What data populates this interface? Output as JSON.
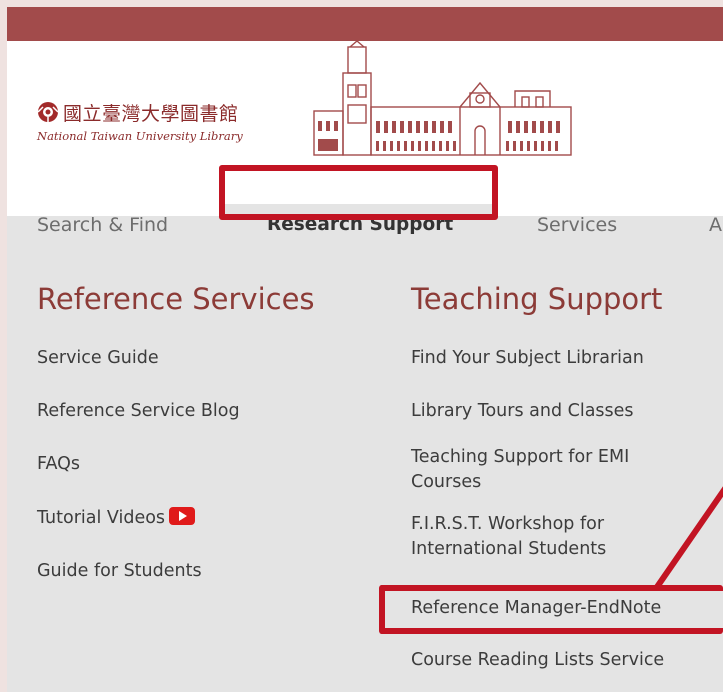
{
  "logo": {
    "name_zh": "國立臺灣大學圖書館",
    "name_en": "National Taiwan University Library"
  },
  "nav": {
    "items": [
      {
        "label": "Search & Find"
      },
      {
        "label": "Research Support"
      },
      {
        "label": "Services"
      },
      {
        "label": "A"
      }
    ]
  },
  "menu": {
    "reference_services": {
      "title": "Reference Services",
      "links": [
        "Service Guide",
        "Reference Service Blog",
        "FAQs",
        "Tutorial Videos",
        "Guide for Students"
      ]
    },
    "teaching_support": {
      "title": "Teaching Support",
      "links": [
        "Find Your Subject Librarian",
        "Library Tours and Classes",
        "Teaching Support for EMI Courses",
        "F.I.R.S.T. Workshop for International Students",
        "Reference Manager-EndNote",
        "Course Reading Lists Service"
      ]
    }
  },
  "colors": {
    "brand": "#a24b4b",
    "title": "#8c3b37",
    "highlight": "#c21423"
  }
}
